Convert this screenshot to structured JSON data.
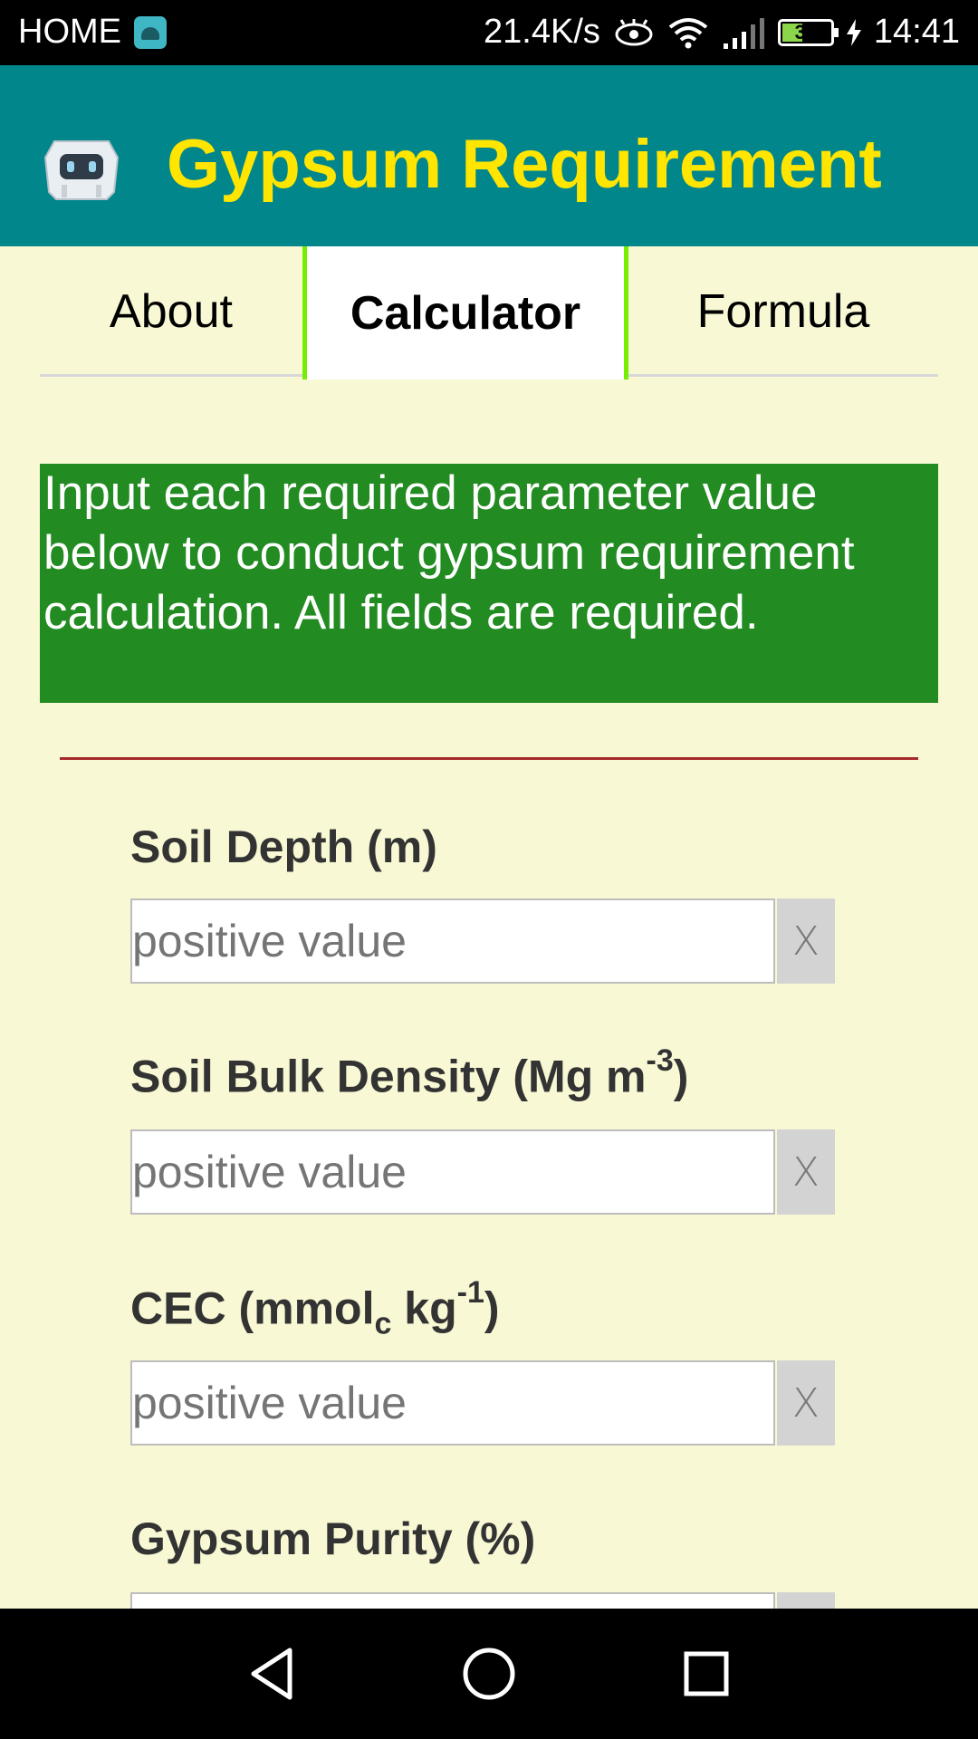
{
  "status_bar": {
    "carrier": "HOME",
    "speed": "21.4K/s",
    "battery": "34",
    "time": "14:41"
  },
  "app": {
    "title": "Gypsum Requirement"
  },
  "tabs": [
    {
      "label": "About"
    },
    {
      "label": "Calculator"
    },
    {
      "label": "Formula"
    }
  ],
  "instructions": "Input each required parameter value below to conduct gypsum requirement calculation. All fields are required.",
  "fields": [
    {
      "label_main": "Soil Depth (m)",
      "placeholder": "positive value",
      "clear": "X"
    },
    {
      "label_main": "Soil Bulk Density (Mg m",
      "label_sup": "-3",
      "label_end": ")",
      "placeholder": "positive value",
      "clear": "X"
    },
    {
      "label_main": "CEC (mmol",
      "label_sub": "c",
      "label_mid": " kg",
      "label_sup": "-1",
      "label_end": ")",
      "placeholder": "positive value",
      "clear": "X"
    },
    {
      "label_main": "Gypsum Purity (%)",
      "placeholder": "",
      "clear": ""
    }
  ],
  "colors": {
    "app_bar": "#00868b",
    "title": "#ffe500",
    "background": "#f8f8d4",
    "instructions_bg": "#228b22",
    "divider": "#a52a2a",
    "tab_active_border": "#76ee00"
  }
}
